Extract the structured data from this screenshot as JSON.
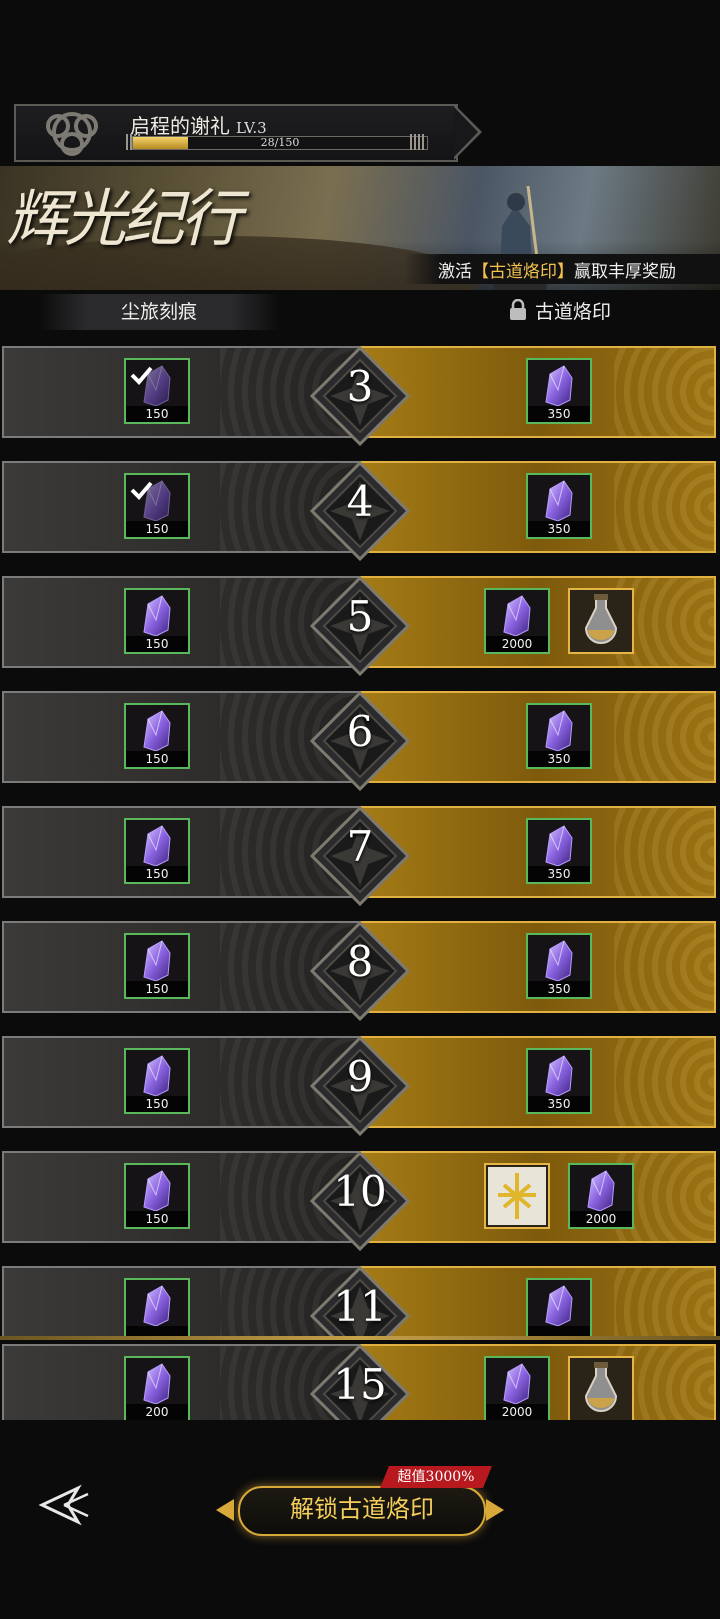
{
  "header": {
    "title": "启程的谢礼",
    "level": "LV.3",
    "xp_text": "28/150",
    "xp_fraction": 0.187
  },
  "banner": {
    "logo": "辉光纪行",
    "promo_prefix": "激活",
    "promo_highlight": "【古道烙印】",
    "promo_suffix": "赢取丰厚奖励"
  },
  "columns": {
    "free": "尘旅刻痕",
    "paid": "古道烙印"
  },
  "rows": [
    {
      "level": "3",
      "free": {
        "qty": "150",
        "claimed": true
      },
      "paid": [
        {
          "type": "crystal",
          "qty": "350"
        }
      ]
    },
    {
      "level": "4",
      "free": {
        "qty": "150",
        "claimed": true
      },
      "paid": [
        {
          "type": "crystal",
          "qty": "350"
        }
      ]
    },
    {
      "level": "5",
      "free": {
        "qty": "150",
        "claimed": false
      },
      "paid": [
        {
          "type": "crystal",
          "qty": "2000"
        },
        {
          "type": "potion",
          "qty": ""
        }
      ]
    },
    {
      "level": "6",
      "free": {
        "qty": "150",
        "claimed": false
      },
      "paid": [
        {
          "type": "crystal",
          "qty": "350"
        }
      ]
    },
    {
      "level": "7",
      "free": {
        "qty": "150",
        "claimed": false
      },
      "paid": [
        {
          "type": "crystal",
          "qty": "350"
        }
      ]
    },
    {
      "level": "8",
      "free": {
        "qty": "150",
        "claimed": false
      },
      "paid": [
        {
          "type": "crystal",
          "qty": "350"
        }
      ]
    },
    {
      "level": "9",
      "free": {
        "qty": "150",
        "claimed": false
      },
      "paid": [
        {
          "type": "crystal",
          "qty": "350"
        }
      ]
    },
    {
      "level": "10",
      "free": {
        "qty": "150",
        "claimed": false
      },
      "paid": [
        {
          "type": "rune",
          "qty": ""
        },
        {
          "type": "crystal",
          "qty": "2000"
        }
      ]
    },
    {
      "level": "11",
      "free": {
        "qty": "",
        "claimed": false
      },
      "paid": [
        {
          "type": "crystal",
          "qty": ""
        }
      ]
    }
  ],
  "pinned_row": {
    "level": "15",
    "free": {
      "qty": "200"
    },
    "paid": [
      {
        "type": "crystal",
        "qty": "2000"
      },
      {
        "type": "potion",
        "qty": ""
      }
    ]
  },
  "footer": {
    "unlock_label": "解锁古道烙印",
    "badge": "超值3000%"
  },
  "colors": {
    "gold": "#e0b040",
    "green_border": "#58b85a",
    "badge_red": "#b7191f"
  }
}
